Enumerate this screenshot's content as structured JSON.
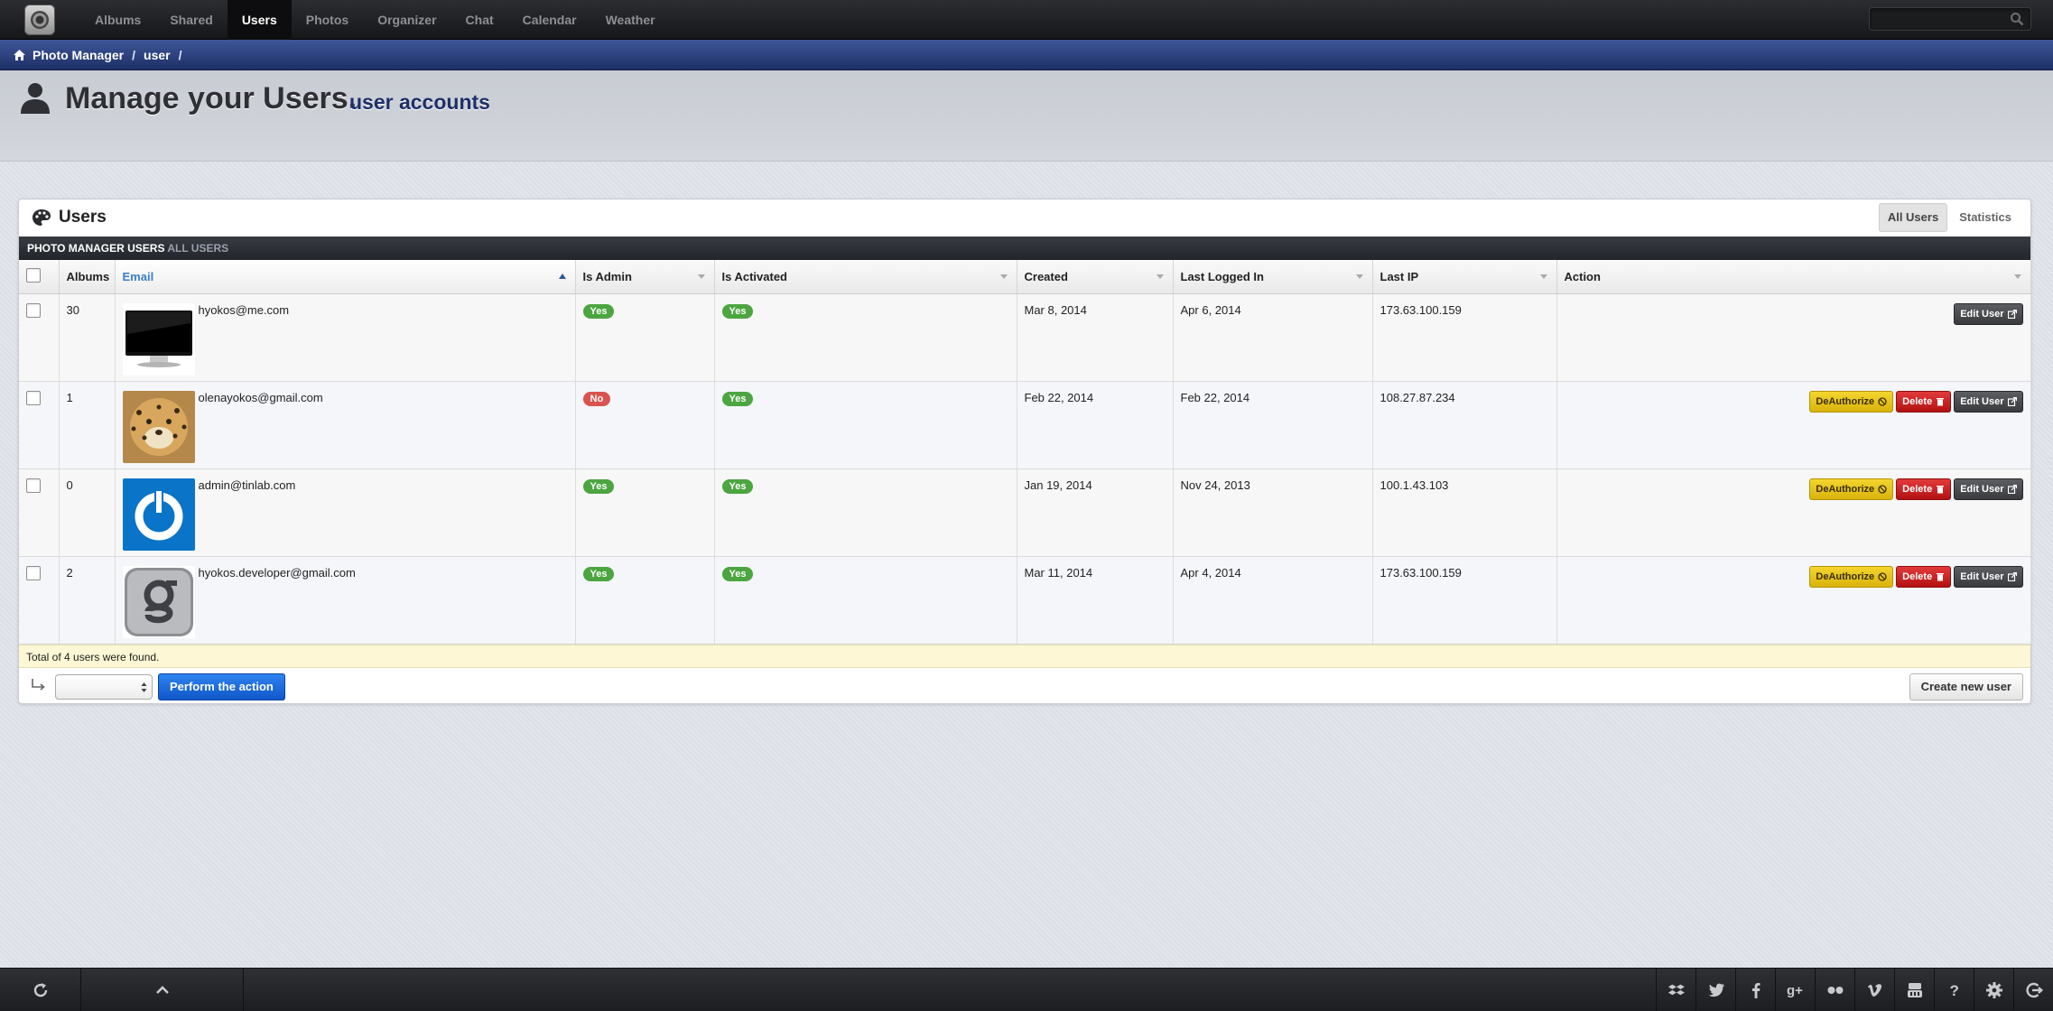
{
  "nav": {
    "items": [
      {
        "label": "Albums",
        "active": false
      },
      {
        "label": "Shared",
        "active": false
      },
      {
        "label": "Users",
        "active": true
      },
      {
        "label": "Photos",
        "active": false
      },
      {
        "label": "Organizer",
        "active": false
      },
      {
        "label": "Chat",
        "active": false
      },
      {
        "label": "Calendar",
        "active": false
      },
      {
        "label": "Weather",
        "active": false
      }
    ],
    "search_placeholder": ""
  },
  "breadcrumb": {
    "home": "Photo Manager",
    "current": "user",
    "sep": "/"
  },
  "page": {
    "title": "Manage your Users.",
    "subtitle": "user accounts"
  },
  "panel": {
    "title": "Users",
    "tabs": [
      "All Users",
      "Statistics"
    ],
    "section_title": "PHOTO MANAGER USERS",
    "section_sub": "ALL USERS"
  },
  "table": {
    "columns": {
      "albums": "Albums",
      "email": "Email",
      "is_admin": "Is Admin",
      "is_activated": "Is Activated",
      "created": "Created",
      "last_logged_in": "Last Logged In",
      "last_ip": "Last IP",
      "action": "Action"
    },
    "rows": [
      {
        "albums": "30",
        "email": "hyokos@me.com",
        "avatar": "monitor",
        "is_admin": "Yes",
        "is_activated": "Yes",
        "created": "Mar 8, 2014",
        "last_logged_in": "Apr 6, 2014",
        "last_ip": "173.63.100.159"
      },
      {
        "albums": "1",
        "email": "olenayokos@gmail.com",
        "avatar": "leopard",
        "is_admin": "No",
        "is_activated": "Yes",
        "created": "Feb 22, 2014",
        "last_logged_in": "Feb 22, 2014",
        "last_ip": "108.27.87.234"
      },
      {
        "albums": "0",
        "email": "admin@tinlab.com",
        "avatar": "power",
        "is_admin": "Yes",
        "is_activated": "Yes",
        "created": "Jan 19, 2014",
        "last_logged_in": "Nov 24, 2013",
        "last_ip": "100.1.43.103"
      },
      {
        "albums": "2",
        "email": "hyokos.developer@gmail.com",
        "avatar": "g-metal",
        "is_admin": "Yes",
        "is_activated": "Yes",
        "created": "Mar 11, 2014",
        "last_logged_in": "Apr 4, 2014",
        "last_ip": "173.63.100.159"
      }
    ],
    "buttons": {
      "deauthorize": "DeAuthorize",
      "delete": "Delete",
      "edit": "Edit User"
    },
    "total": "Total of 4 users were found."
  },
  "bulk": {
    "perform": "Perform the action",
    "create": "Create new user"
  },
  "colors": {
    "yes": "#4ca540",
    "no": "#d9534f",
    "accent": "#1057c9",
    "nav_bg": "#1b1c1f",
    "crumb_bg": "#2c4280"
  },
  "icons": {
    "bottom_left": [
      "refresh-icon",
      "chevron-up-icon"
    ],
    "bottom_right": [
      "dropbox-icon",
      "twitter-icon",
      "facebook-icon",
      "google-plus-icon",
      "flickr-icon",
      "vimeo-icon",
      "youtube-icon",
      "help-icon",
      "settings-icon",
      "logout-icon"
    ]
  }
}
